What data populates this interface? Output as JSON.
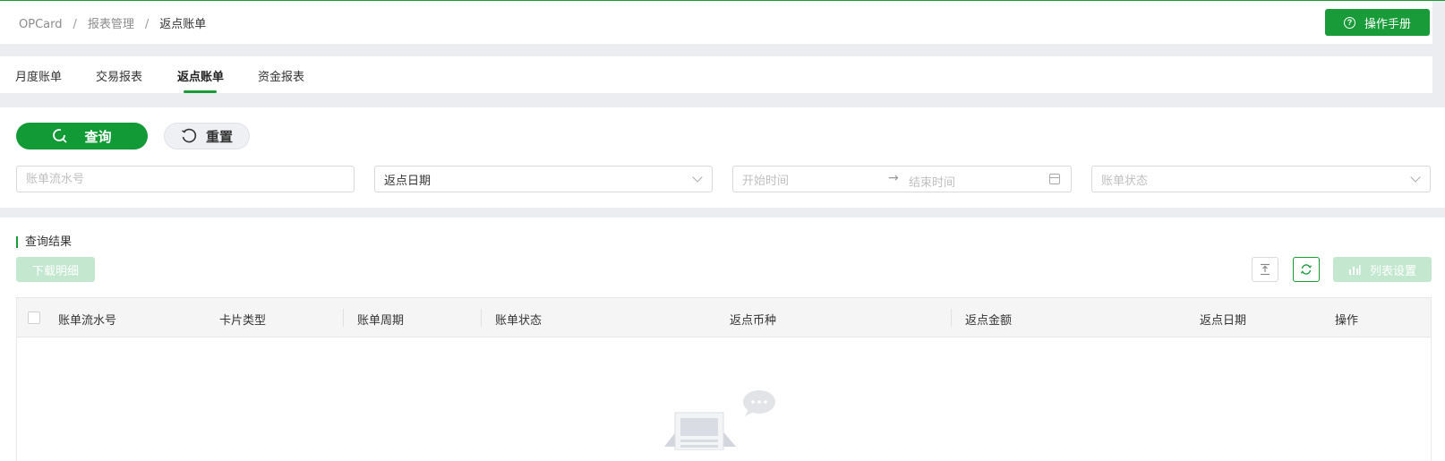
{
  "breadcrumb": {
    "root": "OPCard",
    "parent": "报表管理",
    "current": "返点账单"
  },
  "header": {
    "manual_button": "操作手册"
  },
  "tabs": [
    {
      "label": "月度账单",
      "active": false
    },
    {
      "label": "交易报表",
      "active": false
    },
    {
      "label": "返点账单",
      "active": true
    },
    {
      "label": "资金报表",
      "active": false
    }
  ],
  "filter": {
    "query_button": "查询",
    "reset_button": "重置",
    "bill_no_placeholder": "账单流水号",
    "date_type_value": "返点日期",
    "start_placeholder": "开始时间",
    "end_placeholder": "结束时间",
    "status_placeholder": "账单状态"
  },
  "results": {
    "title": "查询结果",
    "download_button": "下载明细",
    "column_settings_button": "列表设置",
    "columns": [
      "账单流水号",
      "卡片类型",
      "账单周期",
      "账单状态",
      "返点币种",
      "返点金额",
      "返点日期",
      "操作"
    ]
  },
  "colors": {
    "primary": "#1a9b3a",
    "disabled_primary": "#c4e8cf"
  },
  "icons": {
    "manual": "question-circle-icon",
    "query": "search-icon",
    "reset": "refresh-ccw-icon",
    "export": "export-icon",
    "refresh": "sync-icon",
    "column_settings": "bar-chart-icon"
  }
}
